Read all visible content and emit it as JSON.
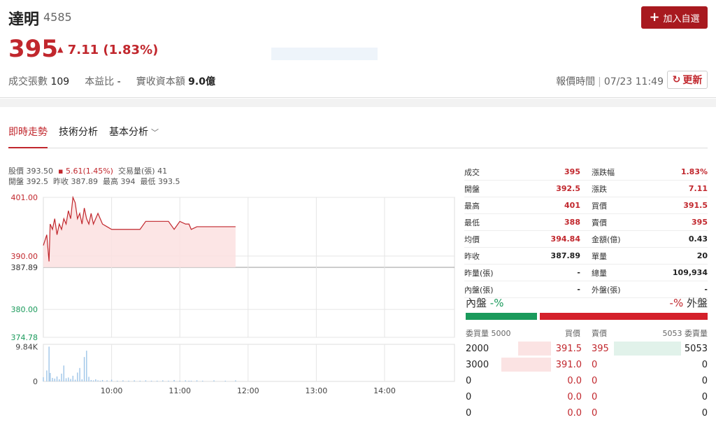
{
  "stock": {
    "name": "達明",
    "code": "4585",
    "price": "395",
    "change_arrow": "▲",
    "change": "7.11 (1.83%)",
    "volume_label": "成交張數",
    "volume": "109",
    "pe_label": "本益比",
    "pe": "-",
    "capital_label": "實收資本額",
    "capital": "9.0億",
    "quote_time_label": "報價時間",
    "quote_time": "07/23 11:49"
  },
  "buttons": {
    "add": "加入自選",
    "refresh": "更新"
  },
  "tabs": [
    "即時走勢",
    "技術分析",
    "基本分析"
  ],
  "chart_info": {
    "line1": {
      "price_label": "股價",
      "price": "393.50",
      "change": "5.61(1.45%)",
      "vol_label": "交易量(張)",
      "vol": "41"
    },
    "line2": {
      "open_label": "開盤",
      "open": "392.5",
      "prev_label": "昨收",
      "prev": "387.89",
      "high_label": "最高",
      "high": "394",
      "low_label": "最低",
      "low": "393.5"
    }
  },
  "chart_data": {
    "type": "line",
    "y_ticks": [
      "401.00",
      "390.00",
      "387.89",
      "380.00",
      "374.78"
    ],
    "x_ticks": [
      "10:00",
      "11:00",
      "12:00",
      "13:00",
      "14:00"
    ],
    "vol_ticks": [
      "9.84K",
      "0"
    ],
    "ylim": [
      374.78,
      401.0
    ],
    "reference": 387.89,
    "x": [
      "09:00",
      "09:03",
      "09:05",
      "09:06",
      "09:08",
      "09:10",
      "09:12",
      "09:14",
      "09:16",
      "09:18",
      "09:20",
      "09:22",
      "09:24",
      "09:26",
      "09:28",
      "09:30",
      "09:32",
      "09:34",
      "09:36",
      "09:38",
      "09:40",
      "09:42",
      "09:44",
      "09:46",
      "09:48",
      "09:50",
      "09:52",
      "09:56",
      "10:00",
      "10:05",
      "10:10",
      "10:15",
      "10:20",
      "10:25",
      "10:30",
      "10:35",
      "10:40",
      "10:45",
      "10:50",
      "10:55",
      "11:00",
      "11:05",
      "11:08",
      "11:10",
      "11:15",
      "11:20",
      "11:30",
      "11:40",
      "11:49"
    ],
    "series": [
      {
        "values": [
          392.0,
          394.0,
          389.0,
          396.0,
          395.0,
          397.0,
          394.0,
          396.0,
          395.0,
          397.0,
          396.0,
          398.5,
          397.0,
          401.0,
          400.0,
          397.0,
          398.0,
          396.0,
          399.0,
          397.0,
          396.0,
          398.0,
          396.0,
          397.0,
          398.0,
          397.0,
          396.0,
          395.5,
          395.0,
          395.0,
          395.0,
          395.0,
          395.0,
          395.0,
          396.5,
          396.5,
          396.5,
          396.5,
          396.5,
          395.0,
          396.5,
          396.0,
          396.0,
          395.0,
          395.5,
          395.5,
          395.5,
          395.5,
          395.5
        ]
      }
    ],
    "volume": [
      1.2,
      3.1,
      9.84,
      2.4,
      1.0,
      0.8,
      1.4,
      0.6,
      2.2,
      4.5,
      0.9,
      1.1,
      0.7,
      1.6,
      0.5,
      2.5,
      3.8,
      0.6,
      6.9,
      8.7,
      1.3,
      0.4,
      0.3,
      0.6,
      0.3,
      0.2,
      0.4,
      0.3,
      0.5,
      0.2,
      0.3,
      0.2,
      0.3,
      0.2,
      0.3,
      0.2,
      0.2,
      0.3,
      0.2,
      0.4,
      0.2,
      0.3,
      0.2,
      0.2,
      0.3,
      0.2,
      0.3,
      0.2,
      0.3
    ]
  },
  "quote_table": [
    {
      "l1": "成交",
      "v1": "395",
      "l2": "漲跌幅",
      "v2": "1.83%",
      "c": "red"
    },
    {
      "l1": "開盤",
      "v1": "392.5",
      "l2": "漲跌",
      "v2": "7.11",
      "c": "red"
    },
    {
      "l1": "最高",
      "v1": "401",
      "l2": "買價",
      "v2": "391.5",
      "c": "red"
    },
    {
      "l1": "最低",
      "v1": "388",
      "l2": "賣價",
      "v2": "395",
      "c": "red"
    },
    {
      "l1": "均價",
      "v1": "394.84",
      "l2": "金額(億)",
      "v2": "0.43",
      "c": "mix"
    },
    {
      "l1": "昨收",
      "v1": "387.89",
      "l2": "單量",
      "v2": "20",
      "c": "dark"
    },
    {
      "l1": "昨量(張)",
      "v1": "-",
      "l2": "總量",
      "v2": "109,934",
      "c": "dark"
    },
    {
      "l1": "內盤(張)",
      "v1": "-",
      "l2": "外盤(張)",
      "v2": "-",
      "c": "dark"
    }
  ],
  "in_out": {
    "in_label": "內盤",
    "in_val": "-%",
    "out_val": "-%",
    "out_label": "外盤",
    "in_ratio": 0.3,
    "out_ratio": 0.7
  },
  "order_book": {
    "head": {
      "bid_vol": "委買量 5000",
      "bid": "買價",
      "ask": "賣價",
      "ask_vol": "5053 委賣量"
    },
    "rows": [
      {
        "bid_vol": "2000",
        "bid": "391.5",
        "ask": "395",
        "ask_vol": "5053"
      },
      {
        "bid_vol": "3000",
        "bid": "391.0",
        "ask": "0",
        "ask_vol": "0"
      },
      {
        "bid_vol": "0",
        "bid": "0.0",
        "ask": "0",
        "ask_vol": "0"
      },
      {
        "bid_vol": "0",
        "bid": "0.0",
        "ask": "0",
        "ask_vol": "0"
      },
      {
        "bid_vol": "0",
        "bid": "0.0",
        "ask": "0",
        "ask_vol": "0"
      }
    ]
  }
}
